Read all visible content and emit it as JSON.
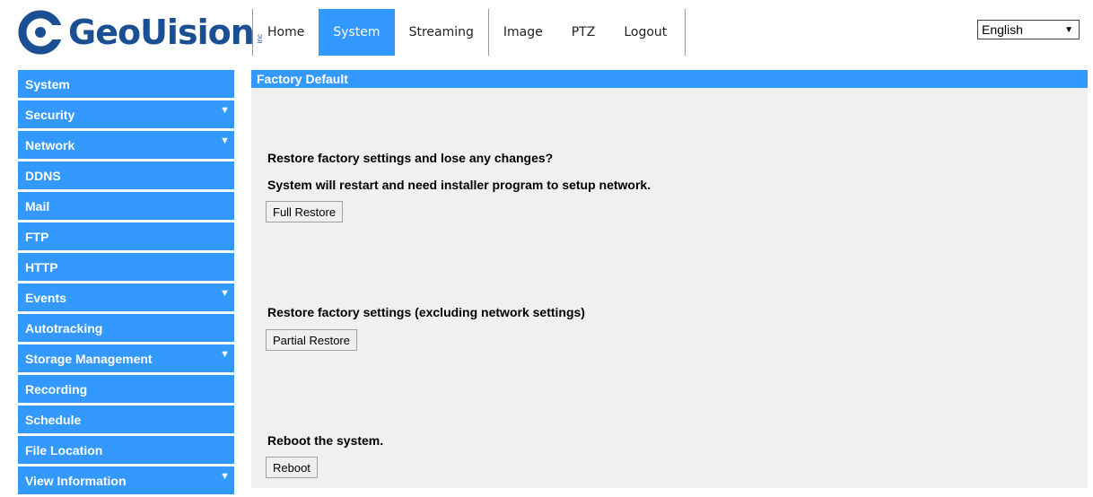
{
  "logo": {
    "text": "GeoUision",
    "suffix": "inc"
  },
  "topnav": {
    "tabs": [
      {
        "label": "Home"
      },
      {
        "label": "System"
      },
      {
        "label": "Streaming"
      },
      {
        "label": "Image"
      },
      {
        "label": "PTZ"
      },
      {
        "label": "Logout"
      }
    ],
    "active": "System"
  },
  "language": {
    "selected": "English"
  },
  "sidebar": {
    "items": [
      {
        "label": "System",
        "expandable": false
      },
      {
        "label": "Security",
        "expandable": true
      },
      {
        "label": "Network",
        "expandable": true
      },
      {
        "label": "DDNS",
        "expandable": false
      },
      {
        "label": "Mail",
        "expandable": false
      },
      {
        "label": "FTP",
        "expandable": false
      },
      {
        "label": "HTTP",
        "expandable": false
      },
      {
        "label": "Events",
        "expandable": true
      },
      {
        "label": "Autotracking",
        "expandable": false
      },
      {
        "label": "Storage Management",
        "expandable": true
      },
      {
        "label": "Recording",
        "expandable": false
      },
      {
        "label": "Schedule",
        "expandable": false
      },
      {
        "label": "File Location",
        "expandable": false
      },
      {
        "label": "View Information",
        "expandable": true
      }
    ]
  },
  "content": {
    "title": "Factory Default",
    "full": {
      "line1": "Restore factory settings and lose any changes?",
      "line2": "System will restart and need installer program to setup network.",
      "button": "Full Restore"
    },
    "partial": {
      "line1": "Restore factory settings (excluding network settings)",
      "button": "Partial Restore"
    },
    "reboot": {
      "line1": "Reboot the system.",
      "button": "Reboot"
    }
  },
  "colors": {
    "accent": "#3399ff",
    "logo": "#1b4f93",
    "panel": "#f0f0f0"
  }
}
